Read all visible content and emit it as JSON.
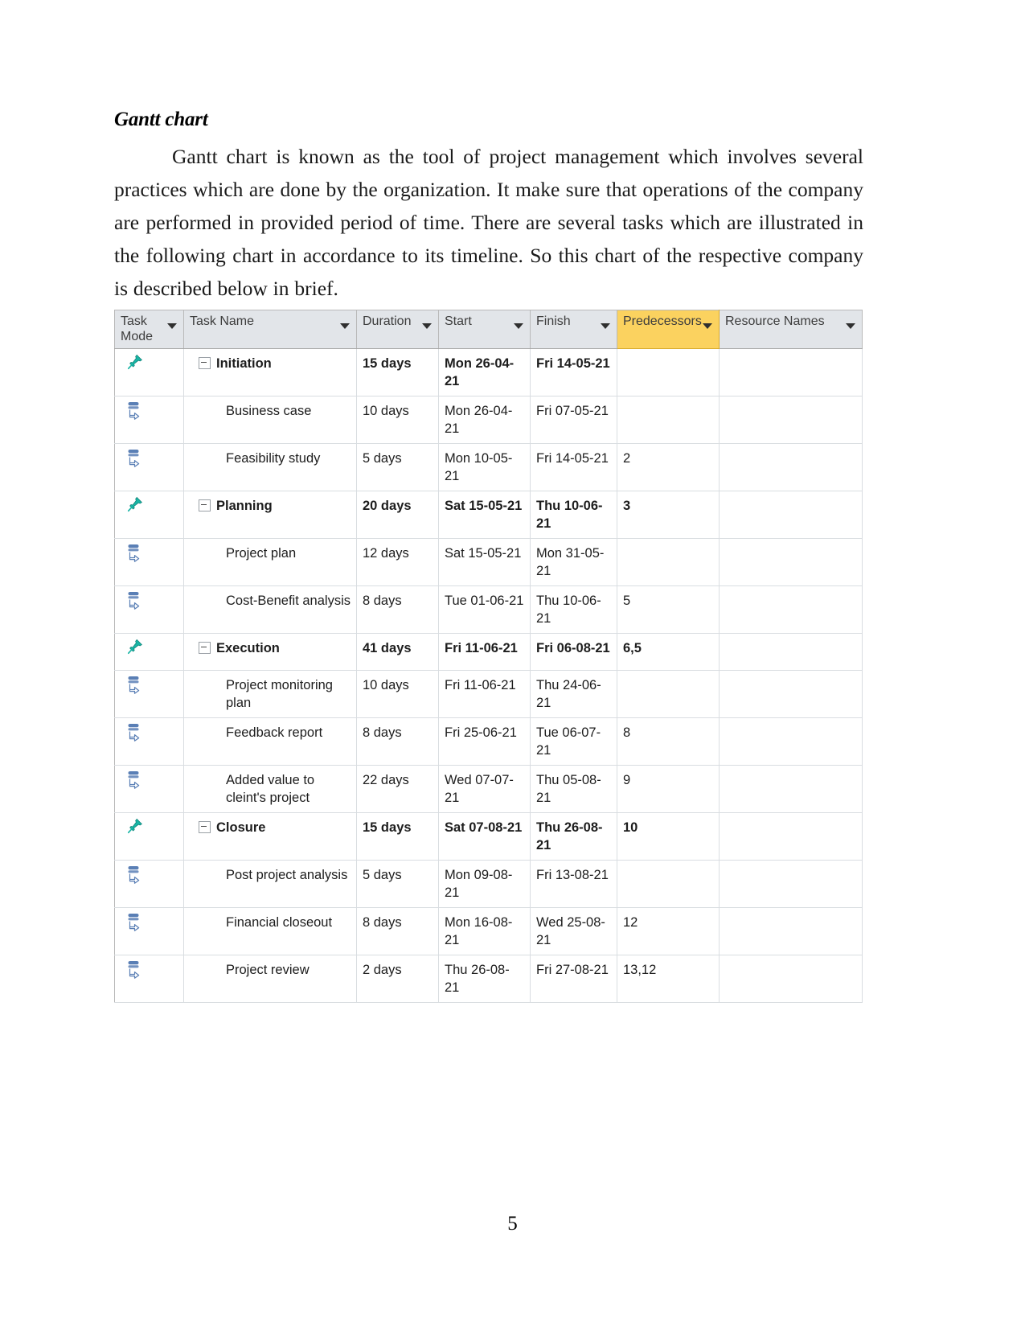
{
  "document": {
    "heading": "Gantt chart",
    "paragraph": "Gantt chart is known as the tool of project management which involves several practices which are done by the organization. It make sure that operations of the company are performed in provided period of time. There are several tasks which are illustrated in the following chart in accordance to its timeline. So this chart of the respective company is described below in brief.",
    "page_number": "5"
  },
  "colors": {
    "header_background": "#e2e5e9",
    "predecessors_header_background": "#fbd25f",
    "grid_line": "#d9dde1",
    "pin_icon": "#19b5a5",
    "auto_icon": "#5a7fb5"
  },
  "chart_data": {
    "type": "table",
    "title": "Gantt chart",
    "columns": [
      {
        "label": "Task Mode",
        "name": "task-mode",
        "highlighted": false
      },
      {
        "label": "Task Name",
        "name": "task-name",
        "highlighted": false
      },
      {
        "label": "Duration",
        "name": "duration",
        "highlighted": false
      },
      {
        "label": "Start",
        "name": "start",
        "highlighted": false
      },
      {
        "label": "Finish",
        "name": "finish",
        "highlighted": false
      },
      {
        "label": "Predecessors",
        "name": "predecessors",
        "highlighted": true
      },
      {
        "label": "Resource Names",
        "name": "resource-names",
        "highlighted": false
      }
    ],
    "rows": [
      {
        "id": 1,
        "mode": "manually-scheduled-pin-icon",
        "name": "Initiation",
        "duration": "15 days",
        "start": "Mon 26-04-21",
        "finish": "Fri 14-05-21",
        "predecessors": "",
        "resources": "",
        "summary": true
      },
      {
        "id": 2,
        "mode": "auto-scheduled-icon",
        "name": "Business case",
        "duration": "10 days",
        "start": "Mon 26-04-21",
        "finish": "Fri 07-05-21",
        "predecessors": "",
        "resources": "",
        "summary": false
      },
      {
        "id": 3,
        "mode": "auto-scheduled-icon",
        "name": "Feasibility study",
        "duration": "5 days",
        "start": "Mon 10-05-21",
        "finish": "Fri 14-05-21",
        "predecessors": "2",
        "resources": "",
        "summary": false
      },
      {
        "id": 4,
        "mode": "manually-scheduled-pin-icon",
        "name": "Planning",
        "duration": "20 days",
        "start": "Sat 15-05-21",
        "finish": "Thu 10-06-21",
        "predecessors": "3",
        "resources": "",
        "summary": true
      },
      {
        "id": 5,
        "mode": "auto-scheduled-icon",
        "name": "Project plan",
        "duration": "12 days",
        "start": "Sat 15-05-21",
        "finish": "Mon 31-05-21",
        "predecessors": "",
        "resources": "",
        "summary": false
      },
      {
        "id": 6,
        "mode": "auto-scheduled-icon",
        "name": "Cost-Benefit analysis",
        "duration": "8 days",
        "start": "Tue 01-06-21",
        "finish": "Thu 10-06-21",
        "predecessors": "5",
        "resources": "",
        "summary": false
      },
      {
        "id": 7,
        "mode": "manually-scheduled-pin-icon",
        "name": "Execution",
        "duration": "41 days",
        "start": "Fri 11-06-21",
        "finish": "Fri 06-08-21",
        "predecessors": "6,5",
        "resources": "",
        "summary": true
      },
      {
        "id": 8,
        "mode": "auto-scheduled-icon",
        "name": "Project monitoring plan",
        "duration": "10 days",
        "start": "Fri 11-06-21",
        "finish": "Thu 24-06-21",
        "predecessors": "",
        "resources": "",
        "summary": false
      },
      {
        "id": 9,
        "mode": "auto-scheduled-icon",
        "name": "Feedback report",
        "duration": "8 days",
        "start": "Fri 25-06-21",
        "finish": "Tue 06-07-21",
        "predecessors": "8",
        "resources": "",
        "summary": false
      },
      {
        "id": 10,
        "mode": "auto-scheduled-icon",
        "name": "Added value to cleint's project",
        "duration": "22 days",
        "start": "Wed 07-07-21",
        "finish": "Thu 05-08-21",
        "predecessors": "9",
        "resources": "",
        "summary": false
      },
      {
        "id": 11,
        "mode": "manually-scheduled-pin-icon",
        "name": "Closure",
        "duration": "15 days",
        "start": "Sat 07-08-21",
        "finish": "Thu 26-08-21",
        "predecessors": "10",
        "resources": "",
        "summary": true
      },
      {
        "id": 12,
        "mode": "auto-scheduled-icon",
        "name": "Post project analysis",
        "duration": "5 days",
        "start": "Mon 09-08-21",
        "finish": "Fri 13-08-21",
        "predecessors": "",
        "resources": "",
        "summary": false
      },
      {
        "id": 13,
        "mode": "auto-scheduled-icon",
        "name": "Financial closeout",
        "duration": "8 days",
        "start": "Mon 16-08-21",
        "finish": "Wed 25-08-21",
        "predecessors": "12",
        "resources": "",
        "summary": false
      },
      {
        "id": 14,
        "mode": "auto-scheduled-icon",
        "name": "Project review",
        "duration": "2 days",
        "start": "Thu 26-08-21",
        "finish": "Fri 27-08-21",
        "predecessors": "13,12",
        "resources": "",
        "summary": false
      }
    ]
  }
}
